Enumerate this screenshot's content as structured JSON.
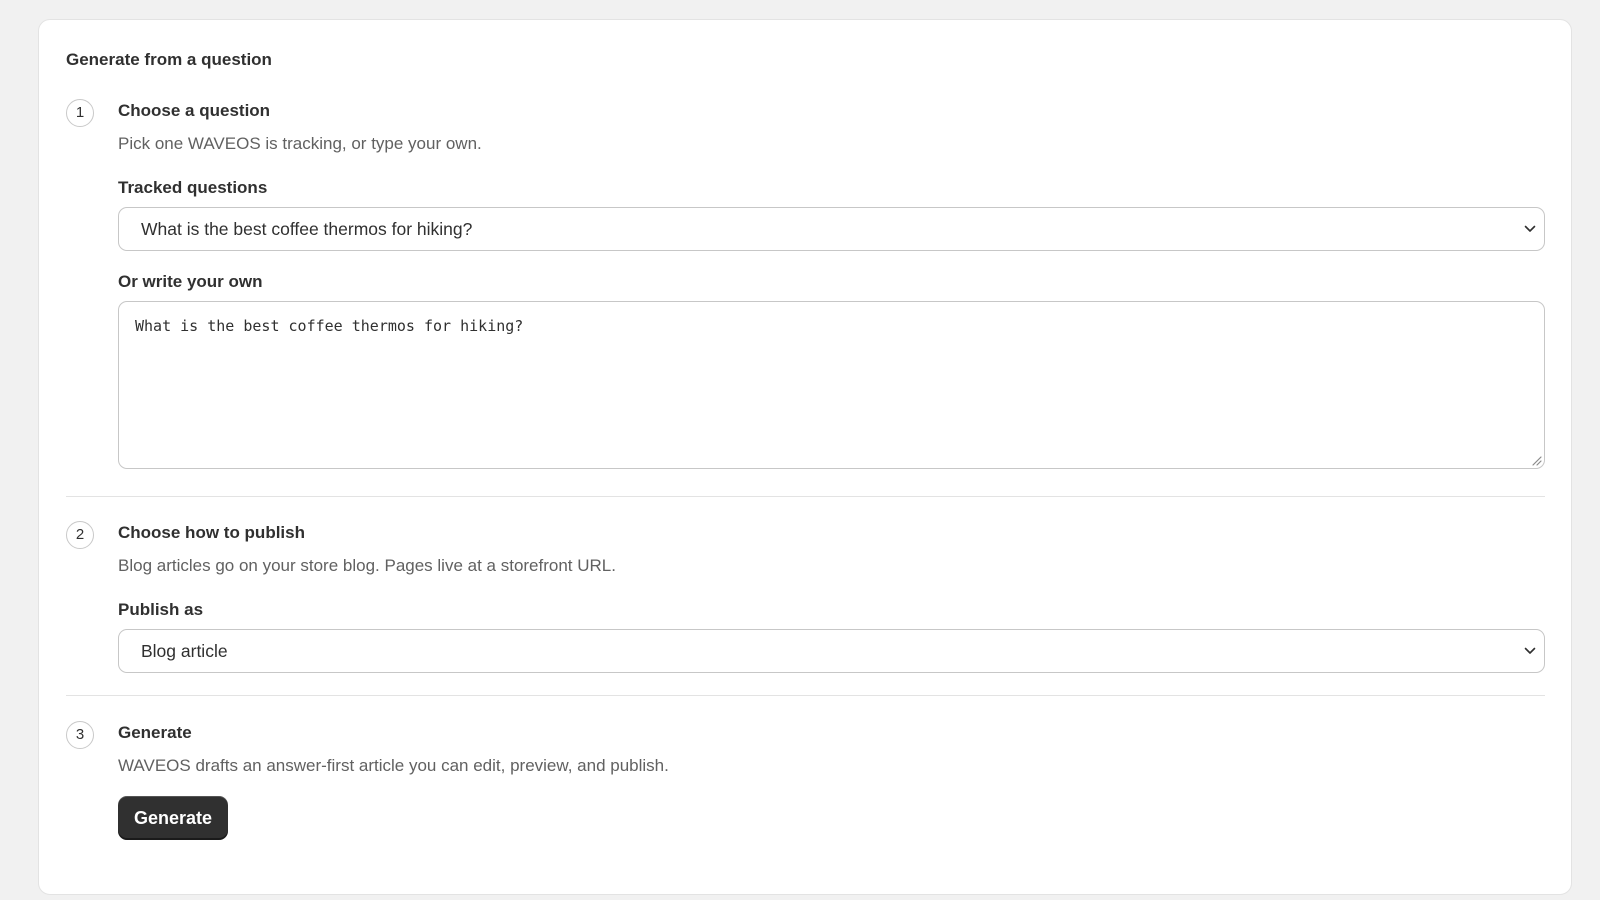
{
  "card": {
    "title": "Generate from a question"
  },
  "steps": [
    {
      "number": "1",
      "title": "Choose a question",
      "description": "Pick one WAVEOS is tracking, or type your own.",
      "tracked_label": "Tracked questions",
      "tracked_selected": "What is the best coffee thermos for hiking?",
      "custom_label": "Or write your own",
      "custom_value": "What is the best coffee thermos for hiking?"
    },
    {
      "number": "2",
      "title": "Choose how to publish",
      "description": "Blog articles go on your store blog. Pages live at a storefront URL.",
      "publish_label": "Publish as",
      "publish_selected": "Blog article"
    },
    {
      "number": "3",
      "title": "Generate",
      "description": "WAVEOS drafts an answer-first article you can edit, preview, and publish.",
      "button_label": "Generate"
    }
  ],
  "icons": {
    "select_chevron": "chevron-down-icon",
    "resize": "resize-handle-icon"
  },
  "colors": {
    "primary_button": "#303030",
    "page_background": "#f1f1f1",
    "card_background": "#ffffff",
    "muted_text": "#616161"
  }
}
